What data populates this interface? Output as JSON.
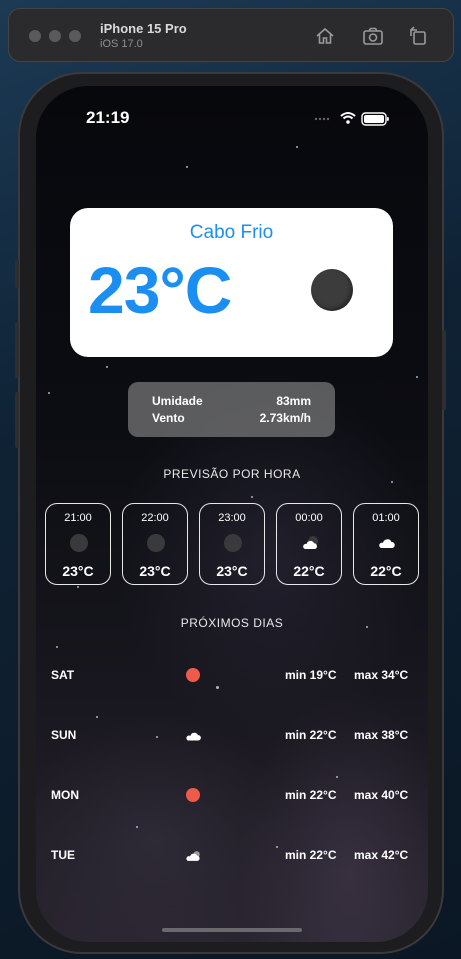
{
  "simulator": {
    "device_name": "iPhone 15 Pro",
    "os_version": "iOS 17.0"
  },
  "status_bar": {
    "time": "21:19"
  },
  "weather": {
    "city": "Cabo Frio",
    "temperature": "23°C",
    "condition_icon": "moon-icon",
    "humidity_label": "Umidade",
    "humidity_value": "83mm",
    "wind_label": "Vento",
    "wind_value": "2.73km/h"
  },
  "hourly": {
    "title": "PREVISÃO POR HORA",
    "items": [
      {
        "time": "21:00",
        "temp": "23°C",
        "icon": "moon-icon"
      },
      {
        "time": "22:00",
        "temp": "23°C",
        "icon": "moon-icon"
      },
      {
        "time": "23:00",
        "temp": "23°C",
        "icon": "moon-icon"
      },
      {
        "time": "00:00",
        "temp": "22°C",
        "icon": "cloud-moon-icon"
      },
      {
        "time": "01:00",
        "temp": "22°C",
        "icon": "cloud-icon"
      }
    ]
  },
  "daily": {
    "title": "PRÓXIMOS DIAS",
    "items": [
      {
        "day": "SAT",
        "min": "min 19°C",
        "max": "max 34°C",
        "icon": "sun-icon"
      },
      {
        "day": "SUN",
        "min": "min 22°C",
        "max": "max 38°C",
        "icon": "cloud-icon"
      },
      {
        "day": "MON",
        "min": "min 22°C",
        "max": "max 40°C",
        "icon": "sun-icon"
      },
      {
        "day": "TUE",
        "min": "min 22°C",
        "max": "max 42°C",
        "icon": "cloud-sun-icon"
      }
    ]
  },
  "colors": {
    "accent": "#1b8ff1",
    "sun": "#ef5b4b",
    "moon": "#3c3c3c"
  }
}
